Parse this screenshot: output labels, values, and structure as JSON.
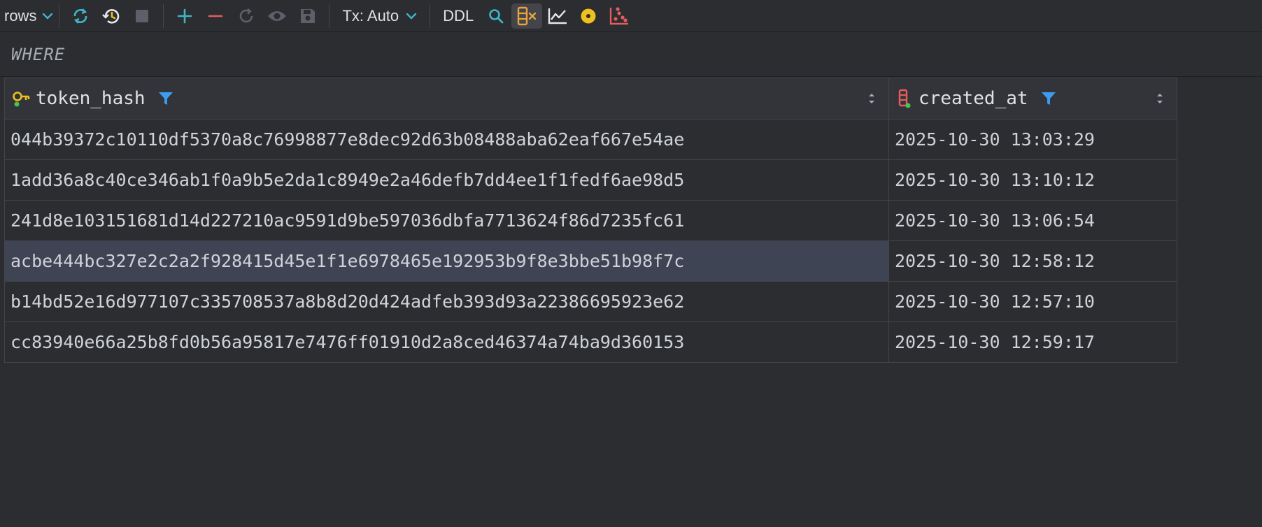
{
  "toolbar": {
    "rows_label": "rows",
    "tx_label": "Tx: Auto",
    "ddl_label": "DDL",
    "icons": [
      "chevron-down-icon",
      "refresh-icon",
      "history-icon",
      "stop-icon",
      "add-row-icon",
      "delete-row-icon",
      "revert-icon",
      "preview-icon",
      "save-icon",
      "search-icon",
      "columns-icon",
      "line-chart-icon",
      "circle-icon",
      "scatter-icon"
    ]
  },
  "filter": {
    "where_label": "WHERE"
  },
  "table": {
    "columns": [
      {
        "name": "token_hash",
        "icon": "primary-key-icon"
      },
      {
        "name": "created_at",
        "icon": "column-icon"
      }
    ],
    "rows": [
      {
        "token_hash": "044b39372c10110df5370a8c76998877e8dec92d63b08488aba62eaf667e54ae",
        "created_at": "2025-10-30 13:03:29"
      },
      {
        "token_hash": "1add36a8c40ce346ab1f0a9b5e2da1c8949e2a46defb7dd4ee1f1fedf6ae98d5",
        "created_at": "2025-10-30 13:10:12"
      },
      {
        "token_hash": "241d8e103151681d14d227210ac9591d9be597036dbfa7713624f86d7235fc61",
        "created_at": "2025-10-30 13:06:54"
      },
      {
        "token_hash": "acbe444bc327e2c2a2f928415d45e1f1e6978465e192953b9f8e3bbe51b98f7c",
        "created_at": "2025-10-30 12:58:12"
      },
      {
        "token_hash": "b14bd52e16d977107c335708537a8b8d20d424adfeb393d93a22386695923e62",
        "created_at": "2025-10-30 12:57:10"
      },
      {
        "token_hash": "cc83940e66a25b8fd0b56a95817e7476ff01910d2a8ced46374a74ba9d360153",
        "created_at": "2025-10-30 12:59:17"
      }
    ]
  },
  "colors": {
    "accent_blue": "#3d9bf0",
    "teal": "#3fb5c8",
    "key_yellow": "#f0c020",
    "red": "#e55c5c",
    "orange": "#e8a33d"
  }
}
